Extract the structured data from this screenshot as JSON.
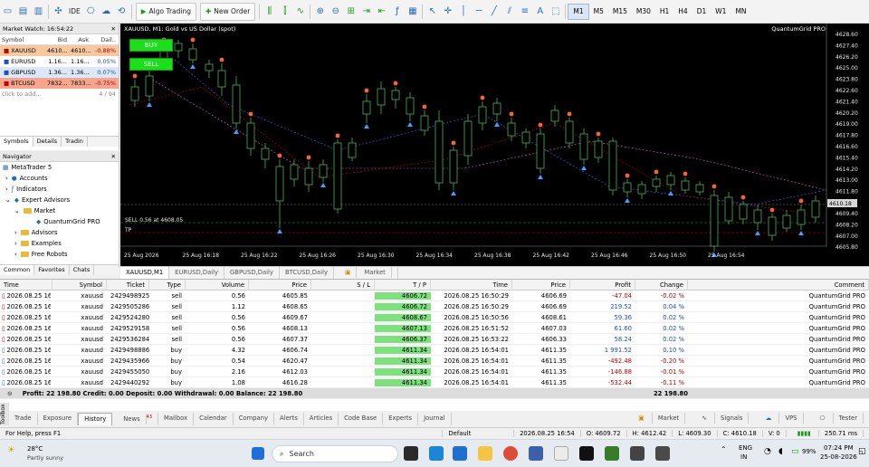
{
  "toolbar": {
    "algo": "Algo Trading",
    "new_order": "New Order",
    "ide": "IDE",
    "timeframes": [
      "M1",
      "M5",
      "M15",
      "M30",
      "H1",
      "H4",
      "D1",
      "W1",
      "MN"
    ],
    "active_tf": "M1"
  },
  "market_watch": {
    "title": "Market Watch: 16:54:22",
    "cols": [
      "Symbol",
      "Bid",
      "Ask",
      "Dail.."
    ],
    "rows": [
      {
        "sym": "XAUUSD",
        "bid": "4610...",
        "ask": "4610...",
        "chg": "-0.88%",
        "bg": "#f8c9a0",
        "chgc": "#c00000"
      },
      {
        "sym": "EURUSD",
        "bid": "1.16...",
        "ask": "1.16...",
        "chg": "0.05%",
        "bg": "#ffffff",
        "chgc": "#1f4fbf"
      },
      {
        "sym": "GBPUSD",
        "bid": "1.36...",
        "ask": "1.36...",
        "chg": "0.07%",
        "bg": "#dbe8fb",
        "chgc": "#1f4fbf"
      },
      {
        "sym": "BTCUSD",
        "bid": "7832...",
        "ask": "7833...",
        "chg": "-0.75%",
        "bg": "#f6a58e",
        "chgc": "#c00000"
      }
    ],
    "add": "click to add...",
    "count": "4 / 94",
    "tabs": [
      "Symbols",
      "Details",
      "Tradin"
    ]
  },
  "navigator": {
    "title": "Navigator",
    "items": [
      "MetaTrader 5",
      "Accounts",
      "Indicators",
      "Expert Advisors",
      "Market",
      "QuantumGrid PRO",
      "Advisors",
      "Examples",
      "Free Robots"
    ],
    "tabs": [
      "Common",
      "Favorites",
      "Chats"
    ]
  },
  "chart": {
    "title": "XAUUSD, M1:  Gold vs US Dollar (spot)",
    "ea": "QuantumGrid PRO",
    "buy": "BUY",
    "sell": "SELL",
    "sell_label": "SELL 0.56 at 4608.05",
    "tp_label": "TP",
    "price_ticks": [
      "4628.60",
      "4627.40",
      "4626.20",
      "4625.00",
      "4623.80",
      "4622.60",
      "4621.40",
      "4620.20",
      "4619.00",
      "4617.80",
      "4616.60",
      "4615.40",
      "4614.20",
      "4613.00",
      "4611.80",
      "4609.40",
      "4608.20",
      "4607.00",
      "4605.80"
    ],
    "cur_price": "4610.18",
    "time_ticks": [
      "25 Aug 2026",
      "25 Aug 16:18",
      "25 Aug 16:22",
      "25 Aug 16:26",
      "25 Aug 16:30",
      "25 Aug 16:34",
      "25 Aug 16:38",
      "25 Aug 16:42",
      "25 Aug 16:46",
      "25 Aug 16:50",
      "25 Aug 16:54"
    ]
  },
  "chart_tabs": [
    "XAUUSD,M1",
    "EURUSD,Daily",
    "GBPUSD,Daily",
    "BTCUSD,Daily",
    "Market"
  ],
  "trades": {
    "cols": [
      "Time",
      "Symbol",
      "Ticket",
      "Type",
      "Volume",
      "Price",
      "S / L",
      "T / P",
      "Time",
      "Price",
      "Profit",
      "Change",
      "Comment"
    ],
    "rows": [
      [
        "2026.08.25 16:47:52",
        "xauusd",
        "2429498925",
        "sell",
        "0.56",
        "4605.85",
        "",
        "4606.72",
        "2026.08.25 16:50:29",
        "4606.69",
        "-47.04",
        "-0.02 %",
        "QuantumGrid PRO"
      ],
      [
        "2026.08.25 16:48:22",
        "xauusd",
        "2429505286",
        "sell",
        "1.12",
        "4608.65",
        "",
        "4606.72",
        "2026.08.25 16:50:29",
        "4606.69",
        "219.52",
        "0.04 %",
        "QuantumGrid PRO"
      ],
      [
        "2026.08.25 16:50:52",
        "xauusd",
        "2429524280",
        "sell",
        "0.56",
        "4609.67",
        "",
        "4608.67",
        "2026.08.25 16:50:56",
        "4608.61",
        "59.36",
        "0.02 %",
        "QuantumGrid PRO"
      ],
      [
        "2026.08.25 16:51:22",
        "xauusd",
        "2429529158",
        "sell",
        "0.56",
        "4608.13",
        "",
        "4607.13",
        "2026.08.25 16:51:52",
        "4607.03",
        "61.60",
        "0.02 %",
        "QuantumGrid PRO"
      ],
      [
        "2026.08.25 16:52:22",
        "xauusd",
        "2429536284",
        "sell",
        "0.56",
        "4607.37",
        "",
        "4606.37",
        "2026.08.25 16:53:22",
        "4606.33",
        "58.24",
        "0.02 %",
        "QuantumGrid PRO"
      ],
      [
        "2026.08.25 16:47:52",
        "xauusd",
        "2429498886",
        "buy",
        "4.32",
        "4606.74",
        "",
        "4611.34",
        "2026.08.25 16:54:01",
        "4611.35",
        "1 991.52",
        "0.10 %",
        "QuantumGrid PRO"
      ],
      [
        "2026.08.25 16:40:52",
        "xauusd",
        "2429435966",
        "buy",
        "0.54",
        "4620.47",
        "",
        "4611.34",
        "2026.08.25 16:54:01",
        "4611.35",
        "-492.48",
        "-0.20 %",
        "QuantumGrid PRO"
      ],
      [
        "2026.08.25 16:42:52",
        "xauusd",
        "2429455050",
        "buy",
        "2.16",
        "4612.03",
        "",
        "4611.34",
        "2026.08.25 16:54:01",
        "4611.35",
        "-146.88",
        "-0.01 %",
        "QuantumGrid PRO"
      ],
      [
        "2026.08.25 16:41:22",
        "xauusd",
        "2429440292",
        "buy",
        "1.08",
        "4616.28",
        "",
        "4611.34",
        "2026.08.25 16:54:01",
        "4611.35",
        "-532.44",
        "-0.11 %",
        "QuantumGrid PRO"
      ]
    ],
    "balance": "Profit: 22 198.80  Credit: 0.00  Deposit: 0.00  Withdrawal: 0.00  Balance: 22 198.80",
    "balance_profit": "22 198.80"
  },
  "bottom_tabs": [
    "Trade",
    "Exposure",
    "History",
    "News",
    "Mailbox",
    "Calendar",
    "Company",
    "Alerts",
    "Articles",
    "Code Base",
    "Experts",
    "Journal"
  ],
  "news_count": "43",
  "toolbox_label": "Toolbox",
  "right_tabs": [
    "Market",
    "Signals",
    "VPS",
    "Tester"
  ],
  "status": {
    "help": "For Help, press F1",
    "profile": "Default",
    "time": "2026.08.25 16:54",
    "o": "O: 4609.72",
    "h": "H: 4612.42",
    "l": "L: 4609.30",
    "c": "C: 4610.18",
    "v": "V: 0",
    "kb": "250.71 ms"
  },
  "taskbar": {
    "temp": "28°C",
    "weather": "Partly sunny",
    "search": "Search",
    "lang": "ENG",
    "region": "IN",
    "battery": "99%",
    "clock": "07:24 PM",
    "date": "25-08-2026"
  }
}
